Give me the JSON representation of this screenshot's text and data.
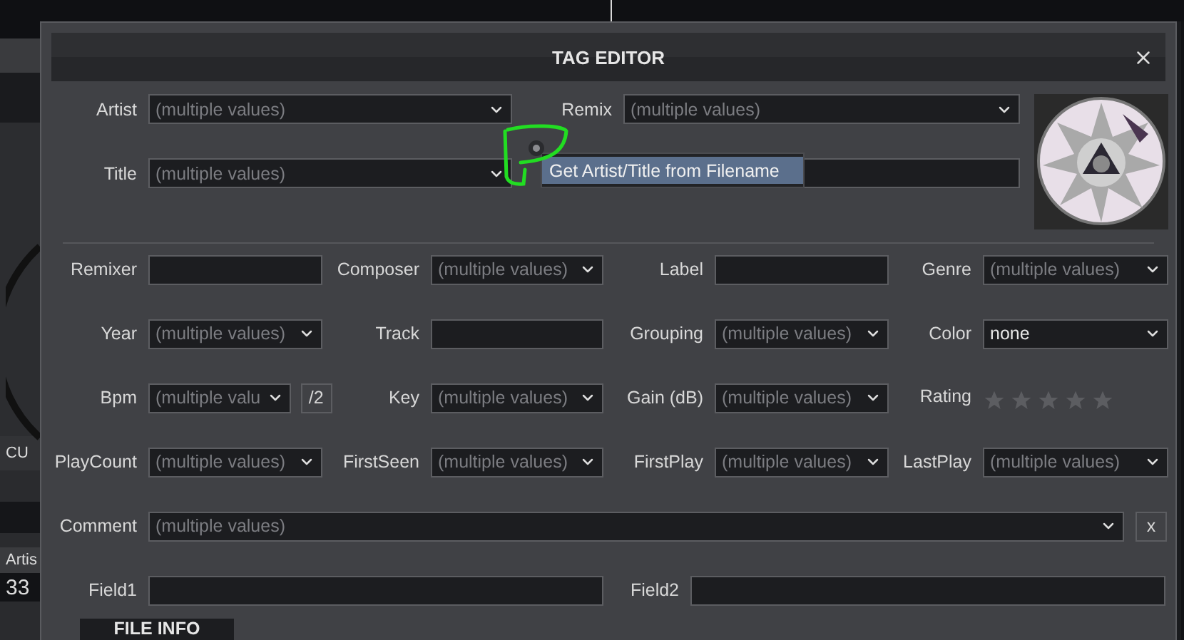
{
  "window": {
    "title": "TAG EDITOR"
  },
  "header_fields": [
    {
      "label": "Artist",
      "kind": "select",
      "placeholder": "(multiple values)"
    },
    {
      "label": "Remix",
      "kind": "select",
      "placeholder": "(multiple values)"
    },
    {
      "label": "Title",
      "kind": "select",
      "placeholder": "(multiple values)"
    },
    {
      "kind": "text"
    }
  ],
  "context_menu": {
    "items": [
      {
        "label": "Get Artist/Title from Filename",
        "selected": true
      }
    ]
  },
  "field_rows": [
    [
      {
        "label": "Remixer",
        "kind": "text"
      },
      {
        "label": "Composer",
        "kind": "select",
        "placeholder": "(multiple values)"
      },
      {
        "label": "Label",
        "kind": "text"
      },
      {
        "label": "Genre",
        "kind": "select",
        "placeholder": "(multiple values)"
      }
    ],
    [
      {
        "label": "Year",
        "kind": "select",
        "placeholder": "(multiple values)"
      },
      {
        "label": "Track",
        "kind": "text"
      },
      {
        "label": "Grouping",
        "kind": "select",
        "placeholder": "(multiple values)"
      },
      {
        "label": "Color",
        "kind": "select",
        "value": "none"
      }
    ],
    [
      {
        "label": "Bpm",
        "kind": "select",
        "placeholder": "(multiple valu",
        "button": "/2"
      },
      {
        "label": "Key",
        "kind": "select",
        "placeholder": "(multiple values)"
      },
      {
        "label": "Gain (dB)",
        "kind": "select",
        "placeholder": "(multiple values)"
      },
      {
        "label": "Rating",
        "kind": "rating",
        "stars": 0
      }
    ],
    [
      {
        "label": "PlayCount",
        "kind": "select",
        "placeholder": "(multiple values)"
      },
      {
        "label": "FirstSeen",
        "kind": "select",
        "placeholder": "(multiple values)"
      },
      {
        "label": "FirstPlay",
        "kind": "select",
        "placeholder": "(multiple values)"
      },
      {
        "label": "LastPlay",
        "kind": "select",
        "placeholder": "(multiple values)"
      }
    ]
  ],
  "comment": {
    "label": "Comment",
    "placeholder": "(multiple values)",
    "clear_button": "x"
  },
  "custom_fields": [
    {
      "label": "Field1"
    },
    {
      "label": "Field2"
    }
  ],
  "file_info_tab": {
    "label": "FILE INFO"
  },
  "background": {
    "deck_button": "CU",
    "column_header": "Artis",
    "row_text": "33"
  }
}
